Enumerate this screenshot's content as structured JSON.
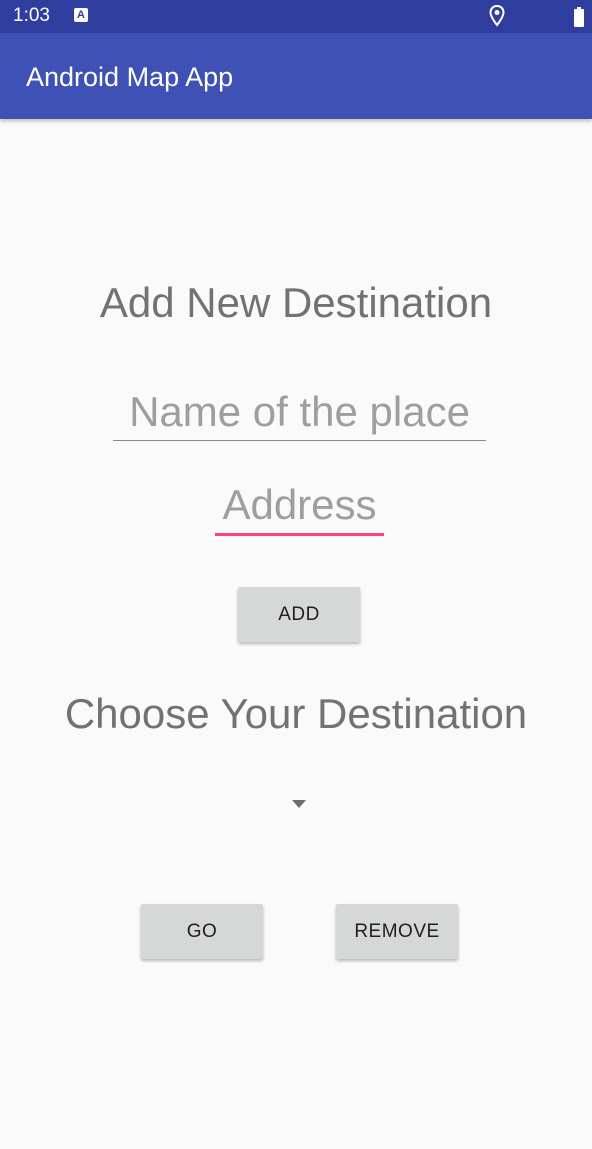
{
  "status_bar": {
    "time": "1:03",
    "notification_icon": "a-icon",
    "location_icon": "location-pin-icon",
    "battery_icon": "battery-full-icon",
    "color": "#2f3e9e"
  },
  "app_bar": {
    "title": "Android Map App",
    "color": "#3f51b5"
  },
  "add_section": {
    "heading": "Add New Destination",
    "name_field": {
      "value": "",
      "placeholder": "Name of the place"
    },
    "address_field": {
      "value": "",
      "placeholder": "Address",
      "focused": true
    },
    "add_button": "ADD"
  },
  "choose_section": {
    "heading": "Choose Your Destination",
    "spinner": {
      "selected": ""
    },
    "go_button": "GO",
    "remove_button": "REMOVE"
  },
  "colors": {
    "accent": "#ff4081",
    "button_bg": "#d6d7d7",
    "heading_text": "#727272"
  }
}
